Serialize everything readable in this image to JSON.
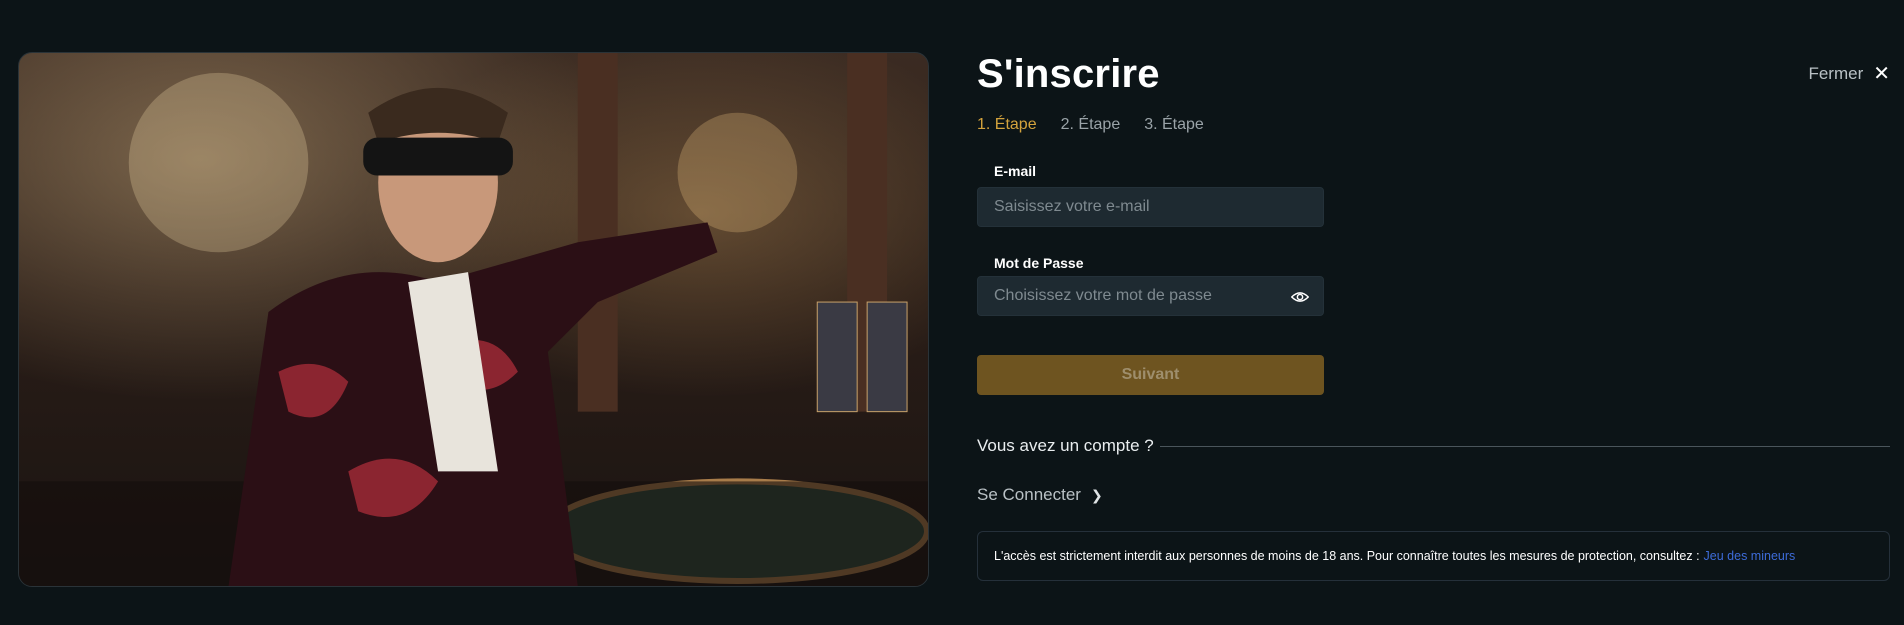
{
  "signup": {
    "title": "S'inscrire",
    "close_label": "Fermer",
    "close_icon": "✕",
    "steps": [
      "1. Étape",
      "2. Étape",
      "3. Étape"
    ],
    "email": {
      "label": "E-mail",
      "placeholder": "Saisissez votre e-mail"
    },
    "password": {
      "label": "Mot de Passe",
      "placeholder": "Choisissez votre mot de passe",
      "toggle_icon": "eye-icon"
    },
    "next_button": "Suivant",
    "have_account": "Vous avez un compte ?",
    "login_link": "Se Connecter",
    "login_chevron": "❯",
    "notice_text": "L'accès est strictement interdit aux personnes de moins de 18 ans. Pour connaître toutes les mesures de protection, consultez :",
    "notice_link": "Jeu des mineurs"
  },
  "colors": {
    "background": "#0c1417",
    "accent": "#d4a33d",
    "button": "#6e5420",
    "link": "#3d6bd8"
  }
}
